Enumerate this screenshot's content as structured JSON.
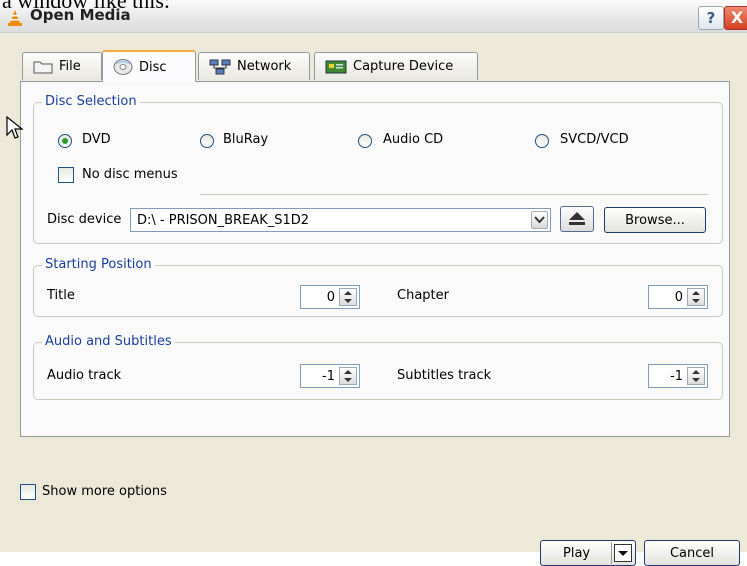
{
  "caption_fragment": "a window like this:",
  "window": {
    "title": "Open Media",
    "help_label": "?",
    "close_label": "X"
  },
  "tabs": [
    {
      "label": "File",
      "icon": "folder-icon",
      "active": false
    },
    {
      "label": "Disc",
      "icon": "disc-icon",
      "active": true
    },
    {
      "label": "Network",
      "icon": "network-icon",
      "active": false
    },
    {
      "label": "Capture Device",
      "icon": "capture-device-icon",
      "active": false
    }
  ],
  "disc_selection": {
    "title": "Disc Selection",
    "options": [
      "DVD",
      "BluRay",
      "Audio CD",
      "SVCD/VCD"
    ],
    "selected": "DVD",
    "no_disc_menus_label": "No disc menus",
    "no_disc_menus_checked": false,
    "device_label": "Disc device",
    "device_value": "D:\\ - PRISON_BREAK_S1D2",
    "browse_label": "Browse..."
  },
  "starting_position": {
    "title": "Starting Position",
    "title_label": "Title",
    "title_value": "0",
    "chapter_label": "Chapter",
    "chapter_value": "0"
  },
  "audio_subtitles": {
    "title": "Audio and Subtitles",
    "audio_label": "Audio track",
    "audio_value": "-1",
    "subtitles_label": "Subtitles track",
    "subtitles_value": "-1"
  },
  "footer": {
    "show_more_label": "Show more options",
    "show_more_checked": false,
    "play_label": "Play",
    "cancel_label": "Cancel"
  },
  "colors": {
    "accent_tab": "#f5a83c",
    "group_title": "#1a3e9c",
    "radio_selected": "#2b9a2b"
  }
}
